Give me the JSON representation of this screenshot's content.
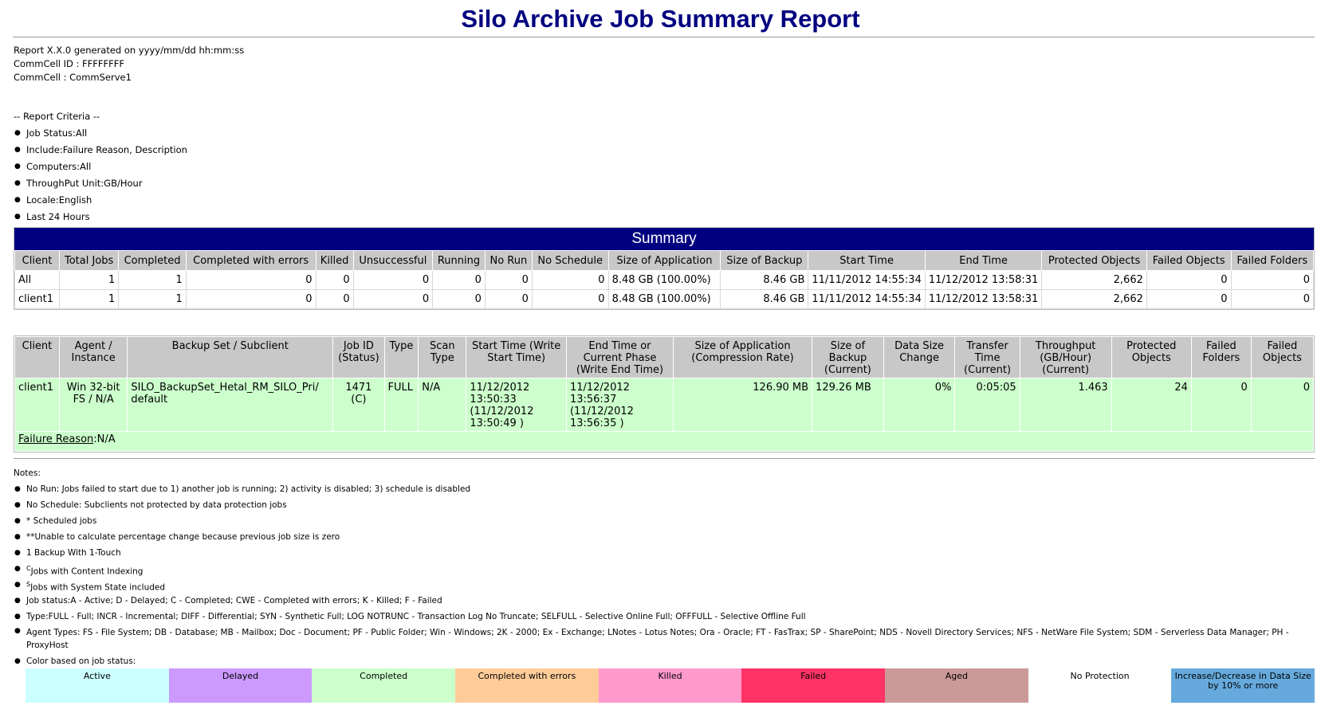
{
  "report_title": "Silo Archive Job Summary Report",
  "meta": {
    "generated": "Report X.X.0 generated on yyyy/mm/dd hh:mm:ss",
    "commcell_id": "CommCell ID : FFFFFFFF",
    "commcell": "CommCell : CommServe1"
  },
  "criteria": {
    "header": "-- Report Criteria --",
    "items": [
      "Job Status:All",
      "Include:Failure Reason, Description",
      "Computers:All",
      "ThroughPut Unit:GB/Hour",
      "Locale:English",
      "Last 24 Hours"
    ]
  },
  "summary": {
    "title": "Summary",
    "headers": [
      "Client",
      "Total Jobs",
      "Completed",
      "Completed with errors",
      "Killed",
      "Unsuccessful",
      "Running",
      "No Run",
      "No Schedule",
      "Size of Application",
      "Size of Backup",
      "Start Time",
      "End Time",
      "Protected Objects",
      "Failed Objects",
      "Failed Folders"
    ],
    "rows": [
      [
        "All",
        "1",
        "1",
        "0",
        "0",
        "0",
        "0",
        "0",
        "0",
        "8.48 GB (100.00%)",
        "8.46 GB",
        "11/11/2012 14:55:34",
        "11/12/2012 13:58:31",
        "2,662",
        "0",
        "0"
      ],
      [
        "client1",
        "1",
        "1",
        "0",
        "0",
        "0",
        "0",
        "0",
        "0",
        "8.48 GB (100.00%)",
        "8.46 GB",
        "11/11/2012 14:55:34",
        "11/12/2012 13:58:31",
        "2,662",
        "0",
        "0"
      ]
    ]
  },
  "jobs": {
    "headers": [
      "Client",
      "Agent / Instance",
      "Backup Set / Subclient",
      "Job ID (Status)",
      "Type",
      "Scan Type",
      "Start Time (Write Start Time)",
      "End Time or Current Phase (Write End Time)",
      "Size of Application (Compression Rate)",
      "Size of Backup (Current)",
      "Data Size Change",
      "Transfer Time (Current)",
      "Throughput (GB/Hour) (Current)",
      "Protected Objects",
      "Failed Folders",
      "Failed Objects"
    ],
    "row": {
      "client": "client1",
      "agent": "Win 32-bit FS / N/A",
      "backup_set": "SILO_BackupSet_Hetal_RM_SILO_Pri/ default",
      "job_id": "1471 (C)",
      "type": "FULL",
      "scan_type": "N/A",
      "start_time": "11/12/2012 13:50:33 (11/12/2012 13:50:49 )",
      "end_time": "11/12/2012 13:56:37 (11/12/2012 13:56:35 )",
      "size_app": "126.90 MB",
      "size_backup": "129.26 MB",
      "data_change": "0%",
      "transfer_time": "0:05:05",
      "throughput": "1.463",
      "protected": "24",
      "failed_folders": "0",
      "failed_objects": "0"
    },
    "failure_label": "Failure Reason",
    "failure_value": ":N/A"
  },
  "notes": {
    "header": "Notes:",
    "items": [
      "No Run: Jobs failed to start due to 1) another job is running; 2) activity is disabled; 3) schedule is disabled",
      "No Schedule: Subclients not protected by data protection jobs",
      "* Scheduled jobs",
      "**Unable to calculate percentage change because previous job size is zero",
      "1 Backup With 1-Touch"
    ],
    "content_indexing": {
      "sup": "C",
      "text": "Jobs with Content Indexing"
    },
    "system_state": {
      "sup": "S",
      "text": "Jobs with System State included"
    },
    "items2": [
      "Job status:A - Active; D - Delayed; C - Completed; CWE - Completed with errors; K - Killed; F - Failed",
      "Type:FULL - Full; INCR - Incremental; DIFF - Differential; SYN - Synthetic Full; LOG NOTRUNC - Transaction Log No Truncate; SELFULL - Selective Online Full; OFFFULL - Selective Offline Full",
      "Agent Types: FS - File System; DB - Database; MB - Mailbox; Doc - Document; PF - Public Folder; Win - Windows; 2K - 2000; Ex - Exchange; LNotes - Lotus Notes; Ora - Oracle; FT - FasTrax; SP - SharePoint; NDS - Novell Directory Services; NFS - NetWare File System; SDM - Serverless Data Manager; PH - ProxyHost",
      "Color based on job status:"
    ]
  },
  "legend": [
    {
      "label": "Active",
      "color": "#ccffff"
    },
    {
      "label": "Delayed",
      "color": "#cc99ff"
    },
    {
      "label": "Completed",
      "color": "#ccffcc"
    },
    {
      "label": "Completed with errors",
      "color": "#ffcc99"
    },
    {
      "label": "Killed",
      "color": "#ff99cc"
    },
    {
      "label": "Failed",
      "color": "#ff3366"
    },
    {
      "label": "Aged",
      "color": "#cc9999"
    },
    {
      "label": "No Protection",
      "color": "#ffffff"
    },
    {
      "label": "Increase/Decrease in Data Size by 10% or more",
      "color": "#66aadd"
    }
  ]
}
